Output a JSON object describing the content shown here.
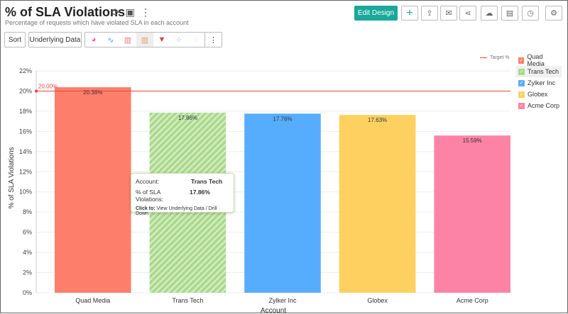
{
  "header": {
    "title": "% of SLA Violations",
    "subtitle": "Percentage of requests which have violated SLA in each account",
    "refresh_icon": "refresh-icon",
    "save_icon": "save-icon",
    "more_icon": "more-icon"
  },
  "toolbar": {
    "sort": "Sort",
    "underlying": "Underlying Data",
    "chart_types": [
      "pie",
      "line",
      "bar",
      "stacked-bar",
      "combo",
      "scatter",
      "map"
    ],
    "selected_type": "stacked-bar"
  },
  "actions": {
    "edit": "Edit Design",
    "icons": [
      "plus-icon",
      "export-icon",
      "email-icon",
      "share-icon",
      "publish-icon",
      "comment-icon",
      "schedule-icon",
      "settings-icon"
    ]
  },
  "tooltip": {
    "k1": "Account:",
    "v1": "Trans Tech",
    "k2": "% of SLA Violations:",
    "v2": "17.86%",
    "click": "Click to:",
    "action": "View Underlying Data / Drill Down"
  },
  "chart_data": {
    "type": "bar",
    "xlabel": "Account",
    "ylabel": "% of SLA Violations",
    "ylim": [
      0,
      22
    ],
    "yticks": [
      "0%",
      "2%",
      "4%",
      "6%",
      "8%",
      "10%",
      "12%",
      "14%",
      "16%",
      "18%",
      "20%",
      "22%"
    ],
    "categories": [
      "Quad Media",
      "Trans Tech",
      "Zylker Inc",
      "Globex",
      "Acme Corp"
    ],
    "values": [
      20.38,
      17.86,
      17.76,
      17.63,
      15.59
    ],
    "labels": [
      "20.38%",
      "17.86%",
      "17.76%",
      "17.63%",
      "15.59%"
    ],
    "colors": [
      "#fe7e6c",
      "#a9d98a",
      "#57adfd",
      "#fed060",
      "#fd83a6"
    ],
    "target": {
      "name": "Target %",
      "value": 20,
      "label": "20.00%",
      "color": "#e8473a"
    },
    "highlighted": "Trans Tech",
    "grid": true,
    "legend_placement": "right"
  }
}
